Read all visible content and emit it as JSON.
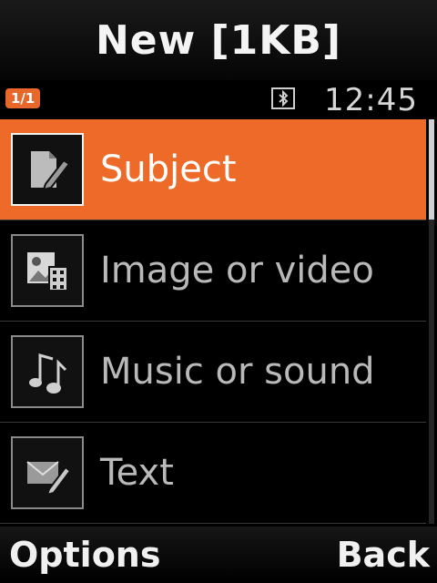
{
  "header": {
    "title": "New [1KB]"
  },
  "status_bar": {
    "page_indicator": "1/1",
    "bluetooth_icon": "bluetooth-icon",
    "time": "12:45"
  },
  "menu": {
    "items": [
      {
        "label": "Subject",
        "icon": "subject-icon",
        "selected": true
      },
      {
        "label": "Image or video",
        "icon": "image-video-icon",
        "selected": false
      },
      {
        "label": "Music or sound",
        "icon": "music-sound-icon",
        "selected": false
      },
      {
        "label": "Text",
        "icon": "text-icon",
        "selected": false
      }
    ]
  },
  "softkeys": {
    "left": "Options",
    "right": "Back"
  },
  "colors": {
    "accent": "#ee6a29",
    "background": "#000000"
  }
}
